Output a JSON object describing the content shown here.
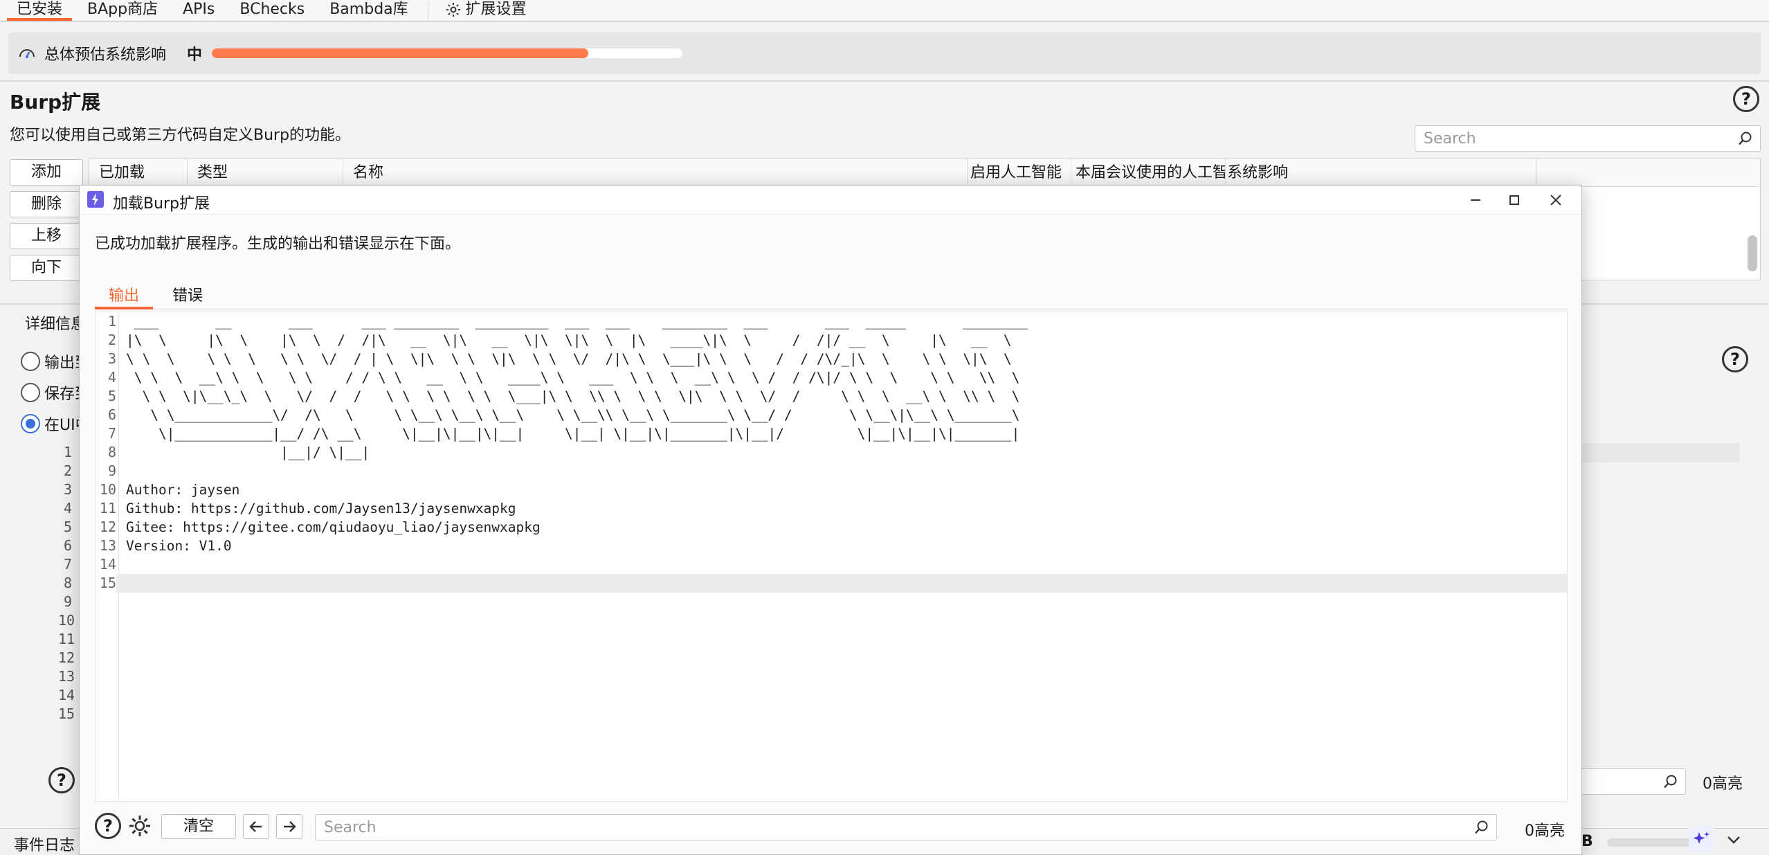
{
  "top_tabs": [
    {
      "label": "已安装",
      "active": true
    },
    {
      "label": "BApp商店"
    },
    {
      "label": "APIs"
    },
    {
      "label": "BChecks"
    },
    {
      "label": "Bambda库"
    }
  ],
  "settings_tab_label": "扩展设置",
  "impact": {
    "label": "总体预估系统影响",
    "level": "中",
    "progress": 0.8
  },
  "page": {
    "title": "Burp扩展",
    "description": "您可以使用自己或第三方代码自定义Burp的功能。",
    "search_placeholder": "Search"
  },
  "side_buttons": [
    "添加",
    "删除",
    "上移",
    "向下"
  ],
  "table_headers": [
    "已加载",
    "类型",
    "名称",
    "启用人工智能",
    "本届会议使用的人工智能积分",
    "系统影响"
  ],
  "details": {
    "tab_label": "详细信息",
    "radio_options": [
      {
        "label": "输出到系统控制台",
        "checked": false
      },
      {
        "label": "保存到文件",
        "checked": false
      },
      {
        "label": "在UI中显示",
        "checked": true
      }
    ],
    "highlight_count": "0高亮"
  },
  "bottom_bar": {
    "event_log": "事件日志",
    "memory_unit": "B"
  },
  "dialog": {
    "title": "加载Burp扩展",
    "message": "已成功加载扩展程序。生成的输出和错误显示在下面。",
    "tabs": [
      {
        "label": "输出",
        "active": true
      },
      {
        "label": "错误"
      }
    ],
    "lines": [
      " ___       __       ___      ___ ________  _________  ___  ___    ________  ___       ___  _____       ________",
      "|\\  \\     |\\  \\    |\\  \\  /  /|\\   __  \\|\\   __  \\|\\  \\|\\  \\  |\\   ____\\|\\  \\     /  /|/ __  \\     |\\   __  \\",
      "\\ \\  \\    \\ \\  \\   \\ \\  \\/  / | \\  \\|\\  \\ \\  \\|\\  \\ \\  \\/  /|\\ \\  \\___|\\ \\  \\   /  / /\\/_|\\  \\    \\ \\  \\|\\  \\",
      " \\ \\  \\  __\\ \\  \\   \\ \\    / / \\ \\   __  \\ \\   ____\\ \\   ___  \\ \\  \\  __\\ \\  \\ /  / /\\|/ \\ \\  \\    \\ \\   \\\\  \\",
      "  \\ \\  \\|\\__\\_\\  \\   \\/  /  /   \\ \\  \\ \\  \\ \\  \\___|\\ \\  \\\\ \\  \\ \\  \\|\\  \\ \\  \\/  /     \\ \\  \\  __\\ \\  \\\\ \\  \\",
      "   \\ \\____________\\/  /\\   \\     \\ \\__\\ \\__\\ \\__\\    \\ \\__\\\\ \\__\\ \\_______\\ \\__/ /       \\ \\__\\|\\__\\ \\_______\\",
      "    \\|____________|__/ /\\ __\\     \\|__|\\|__|\\|__|     \\|__| \\|__|\\|_______|\\|__|/         \\|__|\\|__|\\|_______|",
      "                   |__|/ \\|__|",
      "",
      "Author: jaysen",
      "Github: https://github.com/Jaysen13/jaysenwxapkg",
      "Gitee: https://gitee.com/qiudaoyu_liao/jaysenwxapkg",
      "Version: V1.0",
      "",
      ""
    ],
    "clear_label": "清空",
    "search_placeholder": "Search",
    "highlight_count": "0高亮"
  }
}
